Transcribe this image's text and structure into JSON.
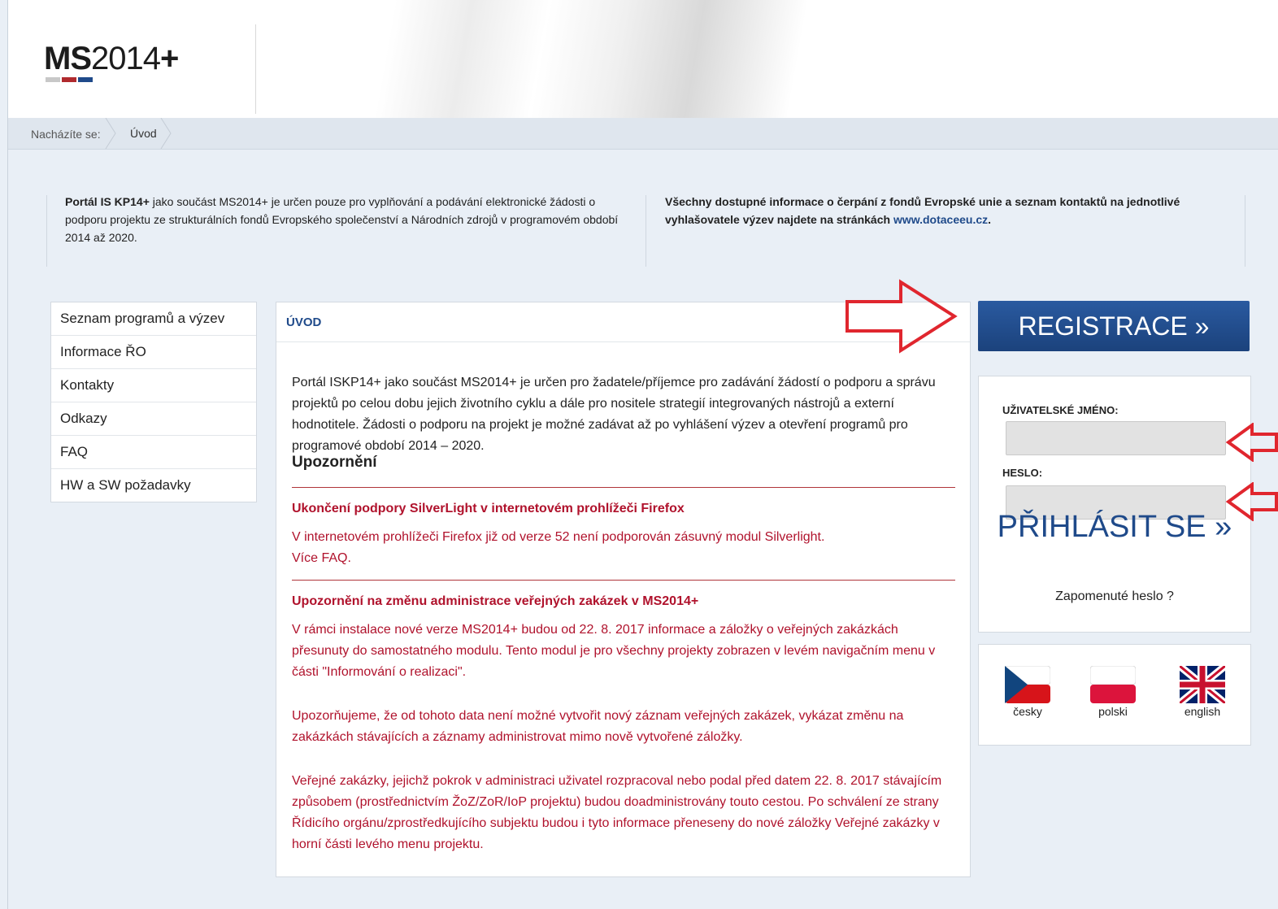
{
  "colors": {
    "brand_blue": "#1f4a8a",
    "notice_red": "#b0122c",
    "arrow_red": "#e0262e"
  },
  "logo": {
    "bold": "MS",
    "rest": "2014",
    "plus": "+"
  },
  "breadcrumb": {
    "label": "Nacházíte se:",
    "current": "Úvod"
  },
  "info_left": {
    "bold": "Portál IS KP14+",
    "text": " jako součást MS2014+ je určen pouze pro vyplňování a podávání elektronické žádosti o podporu projektu ze strukturálních fondů Evropského společenství a Národních zdrojů v programovém období 2014 až 2020."
  },
  "info_right": {
    "text": "Všechny dostupné informace o čerpání z fondů Evropské unie a seznam kontaktů na jednotlivé vyhlašovatele výzev najdete na stránkách ",
    "link": "www.dotaceeu.cz",
    "end": "."
  },
  "menu": [
    "Seznam programů a výzev",
    "Informace ŘO",
    "Kontakty",
    "Odkazy",
    "FAQ",
    "HW a SW požadavky"
  ],
  "panel": {
    "title": "ÚVOD",
    "intro": "Portál ISKP14+ jako součást MS2014+ je určen pro žadatele/příjemce pro zadávání žádostí o podporu a správu projektů po celou dobu jejich životního cyklu a dále pro nositele strategií integrovaných nástrojů a externí hodnotitele. Žádosti o podporu na projekt je možné zadávat až po vyhlášení výzev a otevření programů pro programové období 2014 – 2020.",
    "warning_title": "Upozornění",
    "notices": [
      {
        "title": "Ukončení podpory SilverLight v internetovém prohlížeči Firefox",
        "text": "V internetovém prohlížeči Firefox již od verze 52 není podporován zásuvný modul Silverlight.",
        "link": "Více FAQ."
      },
      {
        "title": "Upozornění na změnu administrace veřejných zakázek v MS2014+",
        "p1": "V rámci instalace nové verze MS2014+ budou od 22. 8. 2017 informace a záložky o veřejných zakázkách přesunuty do samostatného modulu. Tento modul je pro všechny projekty zobrazen v levém navigačním menu v části \"Informování o realizaci\".",
        "p2": "Upozorňujeme, že od tohoto data není možné vytvořit nový záznam veřejných zakázek, vykázat změnu na zakázkách stávajících a záznamy administrovat mimo nově vytvořené záložky.",
        "p3": "Veřejné zakázky, jejichž pokrok v administraci uživatel rozpracoval nebo podal před datem 22. 8. 2017 stávajícím způsobem (prostřednictvím ŽoZ/ZoR/IoP projektu) budou doadministrovány touto cestou. Po schválení ze strany Řídicího orgánu/zprostředkujícího subjektu budou i tyto informace přeneseny do nové záložky Veřejné zakázky v horní části levého menu projektu."
      }
    ]
  },
  "registration": {
    "label": "REGISTRACE »"
  },
  "login": {
    "username_label": "UŽIVATELSKÉ JMÉNO:",
    "username_value": "",
    "password_label": "HESLO:",
    "password_value": "",
    "submit": "PŘIHLÁSIT SE »",
    "forgot": "Zapomenuté heslo ?"
  },
  "languages": [
    {
      "label": "česky",
      "icon": "czech-flag-icon"
    },
    {
      "label": "polski",
      "icon": "polish-flag-icon"
    },
    {
      "label": "english",
      "icon": "uk-flag-icon"
    }
  ]
}
